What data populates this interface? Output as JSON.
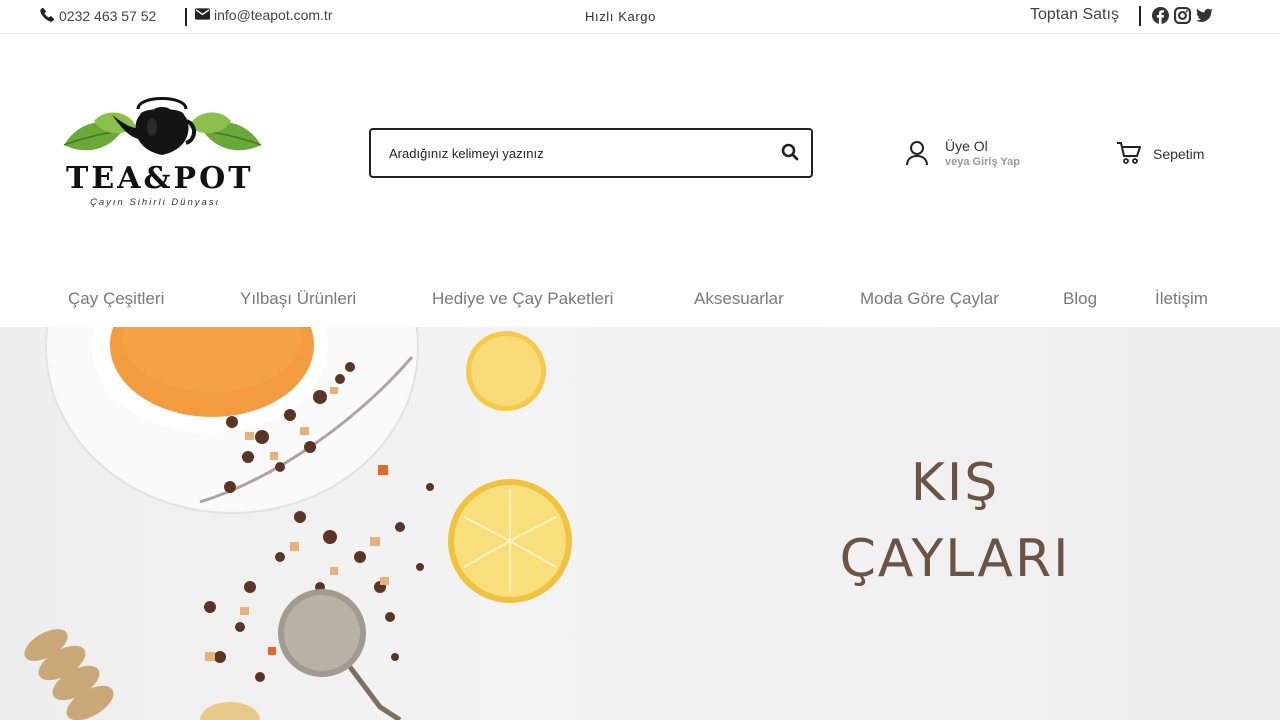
{
  "topbar": {
    "phone": "0232 463 57 52",
    "email": "info@teapot.com.tr",
    "shipping": "Hızlı Kargo",
    "wholesale": "Toptan Satış",
    "social": [
      "facebook-icon",
      "instagram-icon",
      "twitter-icon"
    ]
  },
  "logo": {
    "title": "TEA&POT",
    "tagline": "Çayın Sihirli Dünyası"
  },
  "search": {
    "placeholder": "Aradığınız kelimeyi yazınız"
  },
  "account": {
    "line1": "Üye Ol",
    "line2": "veya Giriş Yap"
  },
  "cart": {
    "label": "Sepetim"
  },
  "nav": {
    "items": [
      {
        "label": "Çay Çeşitleri"
      },
      {
        "label": "Yılbaşı Ürünleri"
      },
      {
        "label": "Hediye ve Çay Paketleri"
      },
      {
        "label": "Aksesuarlar"
      },
      {
        "label": "Moda Göre Çaylar"
      },
      {
        "label": "Blog"
      },
      {
        "label": "İletişim"
      }
    ]
  },
  "hero": {
    "line1": "KIŞ",
    "line2": "ÇAYLARI"
  },
  "colors": {
    "hero_text": "#6b5346",
    "nav_text": "#7a7a7a",
    "tea": "#f39c3f",
    "lemon": "#f7d35a"
  }
}
